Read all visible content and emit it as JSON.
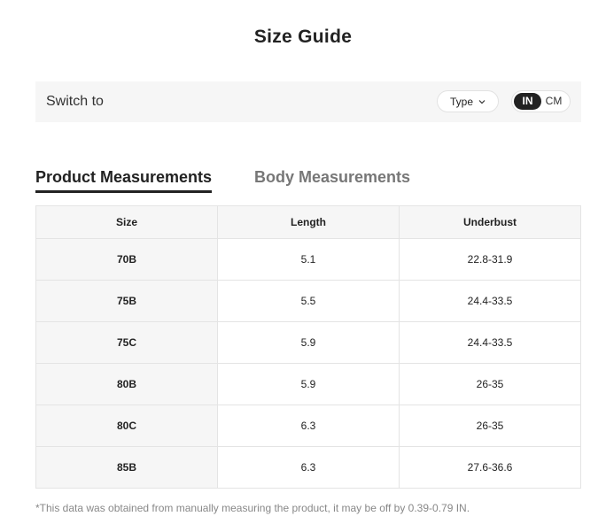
{
  "title": "Size Guide",
  "switch_bar": {
    "label": "Switch to",
    "type_dropdown": {
      "label": "Type",
      "icon": "chevron-down-icon"
    },
    "units": {
      "active": "IN",
      "inactive": "CM"
    }
  },
  "tabs": [
    {
      "label": "Product Measurements",
      "active": true
    },
    {
      "label": "Body Measurements",
      "active": false
    }
  ],
  "table": {
    "headers": [
      "Size",
      "Length",
      "Underbust"
    ],
    "rows": [
      [
        "70B",
        "5.1",
        "22.8-31.9"
      ],
      [
        "75B",
        "5.5",
        "24.4-33.5"
      ],
      [
        "75C",
        "5.9",
        "24.4-33.5"
      ],
      [
        "80B",
        "5.9",
        "26-35"
      ],
      [
        "80C",
        "6.3",
        "26-35"
      ],
      [
        "85B",
        "6.3",
        "27.6-36.6"
      ]
    ]
  },
  "footnote": "*This data was obtained from manually measuring the product, it may be off by 0.39-0.79 IN.",
  "colors": {
    "accent": "#222222",
    "bar_background": "#f6f6f6",
    "inactive_tab": "#777777",
    "footnote": "#888888"
  }
}
